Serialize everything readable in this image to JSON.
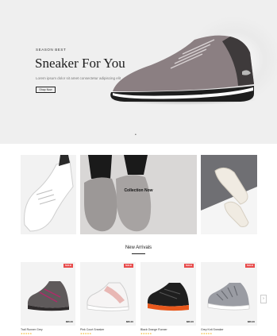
{
  "hero": {
    "eyebrow": "Season Best",
    "title": "Sneaker For You",
    "subtitle": "Lorem ipsum dolor sit amet consectetur adipiscing elit",
    "button_label": "Shop Now",
    "slider_dots": "•"
  },
  "promos": [
    {
      "label": ""
    },
    {
      "label": "Collection Now"
    },
    {
      "label": ""
    }
  ],
  "new_arrivals": {
    "title": "New Arrivals",
    "products": [
      {
        "name": "Trail Runner Grey",
        "price": "$66.00",
        "badge": "SALE",
        "rating": "★★★★★"
      },
      {
        "name": "Pink Court Sneaker",
        "price": "$66.00",
        "badge": "SALE",
        "rating": "★★★★★"
      },
      {
        "name": "Black Orange Runner",
        "price": "$66.00",
        "badge": "SALE",
        "rating": "★★★★★"
      },
      {
        "name": "Grey Knit Sneaker",
        "price": "$66.00",
        "badge": "SALE",
        "rating": "★★★★★"
      }
    ],
    "next_arrow": "›"
  }
}
